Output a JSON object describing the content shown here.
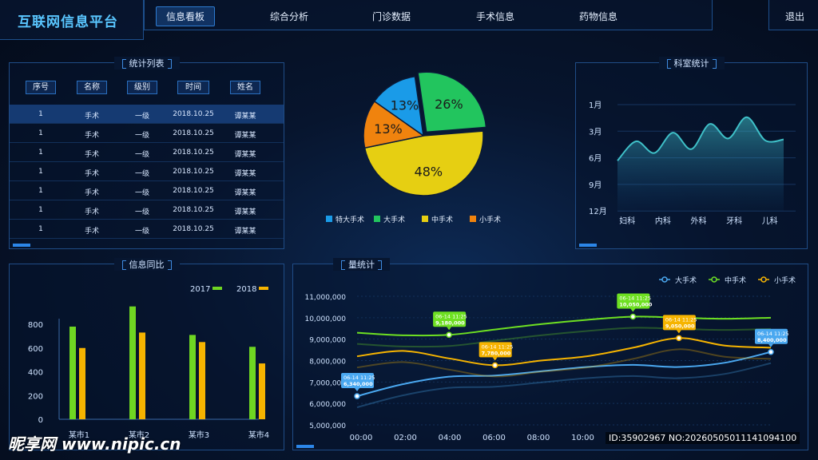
{
  "header": {
    "brand": "互联网信息平台",
    "nav": [
      "信息看板",
      "综合分析",
      "门诊数据",
      "手术信息",
      "药物信息"
    ],
    "active_nav": 0,
    "logout": "退出"
  },
  "stats_table": {
    "title": "统计列表",
    "columns": [
      "序号",
      "名称",
      "级别",
      "时间",
      "姓名"
    ],
    "rows": [
      [
        "1",
        "手术",
        "一级",
        "2018.10.25",
        "谭某某"
      ],
      [
        "1",
        "手术",
        "一级",
        "2018.10.25",
        "谭某某"
      ],
      [
        "1",
        "手术",
        "一级",
        "2018.10.25",
        "谭某某"
      ],
      [
        "1",
        "手术",
        "一级",
        "2018.10.25",
        "谭某某"
      ],
      [
        "1",
        "手术",
        "一级",
        "2018.10.25",
        "谭某某"
      ],
      [
        "1",
        "手术",
        "一级",
        "2018.10.25",
        "谭某某"
      ],
      [
        "1",
        "手术",
        "一级",
        "2018.10.25",
        "谭某某"
      ]
    ]
  },
  "chart_data": [
    {
      "type": "pie",
      "labels": [
        "特大手术",
        "大手术",
        "中手术",
        "小手术"
      ],
      "values": [
        13,
        26,
        48,
        13
      ],
      "value_labels": [
        "13%",
        "26%",
        "48%",
        "13%"
      ],
      "colors": [
        "#1a9be8",
        "#22c55e",
        "#e6cf12",
        "#f0830e"
      ]
    },
    {
      "type": "area",
      "title": "科室统计",
      "categories": [
        "妇科",
        "内科",
        "外科",
        "牙科",
        "儿科"
      ],
      "y_ticks": [
        "1月",
        "3月",
        "6月",
        "9月",
        "12月"
      ],
      "series": [
        {
          "values": [
            6.8,
            4.8,
            6.0,
            3.9,
            5.6,
            3.0,
            4.5,
            2.3,
            4.7,
            4.6
          ]
        }
      ],
      "color": "#3fc0c8"
    },
    {
      "type": "bar",
      "title": "信息同比",
      "categories": [
        "某市1",
        "某市2",
        "某市3",
        "某市4"
      ],
      "series": [
        {
          "name": "2017",
          "values": [
            780,
            950,
            710,
            610
          ],
          "color": "#6fd622"
        },
        {
          "name": "2018",
          "values": [
            600,
            730,
            650,
            470
          ],
          "color": "#f6b400"
        }
      ],
      "ylim": [
        0,
        800
      ],
      "yticks": [
        0,
        200,
        400,
        600,
        800
      ]
    },
    {
      "type": "line",
      "title": "量统计",
      "x": [
        "00:00",
        "02:00",
        "04:00",
        "06:00",
        "08:00",
        "10:00"
      ],
      "y_ticks": [
        "5,000,000",
        "6,000,000",
        "7,000,000",
        "8,000,000",
        "9,000,000",
        "10,000,000",
        "11,000,000"
      ],
      "ylim": [
        5000000,
        11000000
      ],
      "series": [
        {
          "name": "大手术",
          "color": "#4aa8f0",
          "values": [
            6340000,
            6900000,
            7250000,
            7300000,
            7500000,
            7700000,
            7800000,
            7700000,
            7900000,
            8400000
          ]
        },
        {
          "name": "中手术",
          "color": "#6ee022",
          "values": [
            9300000,
            9180000,
            9200000,
            9450000,
            9700000,
            9900000,
            10050000,
            10000000,
            9950000,
            10000000
          ]
        },
        {
          "name": "小手术",
          "color": "#f6b400",
          "values": [
            8200000,
            8450000,
            8100000,
            7780000,
            8000000,
            8200000,
            8600000,
            9050000,
            8700000,
            8600000
          ]
        }
      ],
      "annotations": [
        {
          "series": 0,
          "point": 0,
          "time": "06-14 11:25",
          "value": "6,340,000"
        },
        {
          "series": 1,
          "point": 2,
          "time": "06-14 11:25",
          "value": "9,180,000"
        },
        {
          "series": 2,
          "point": 3,
          "time": "06-14 11:25",
          "value": "7,780,000"
        },
        {
          "series": 1,
          "point": 6,
          "time": "06-14 11:25",
          "value": "10,050,000"
        },
        {
          "series": 2,
          "point": 7,
          "time": "06-14 11:25",
          "value": "9,050,000"
        },
        {
          "series": 0,
          "point": 9,
          "time": "06-14 11:25",
          "value": "8,400,000"
        }
      ]
    }
  ],
  "watermark": {
    "site": "昵享网 www.nipic.cn",
    "id": "ID:35902967 NO:20260505011141094100"
  }
}
